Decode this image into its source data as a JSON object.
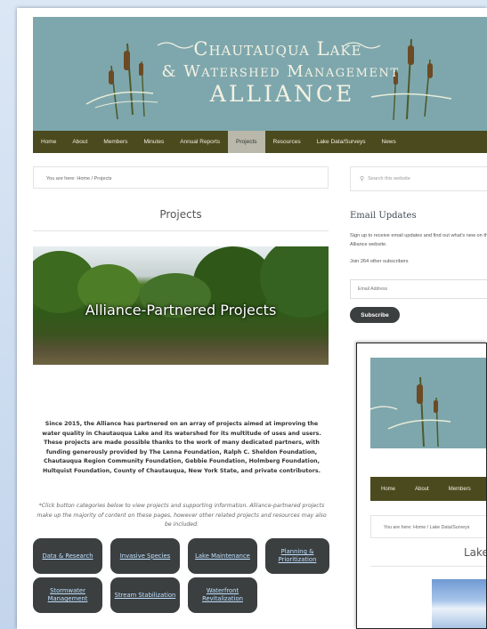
{
  "banner": {
    "line1": "Chautauqua Lake",
    "line2": "& Watershed Management",
    "line3": "ALLIANCE"
  },
  "nav": {
    "items": [
      "Home",
      "About",
      "Members",
      "Minutes",
      "Annual Reports",
      "Projects",
      "Resources",
      "Lake Data/Surveys",
      "News"
    ],
    "active": "Projects"
  },
  "breadcrumb": "You are here: Home / Projects",
  "page_title": "Projects",
  "hero_title": "Alliance-Partnered Projects",
  "intro": "Since 2015, the Alliance has partnered on an array of projects aimed at improving the water quality in Chautauqua Lake and its watershed for its multitude of uses and users. These projects are made possible thanks to the work of many dedicated partners, with funding generously provided by The Lenna Foundation, Ralph C. Sheldon Foundation, Chautauqua Region Community Foundation, Gebbie Foundation, Holmberg Foundation, Hultquist Foundation, County of Chautauqua, New York State, and private contributors.",
  "note": "*Click button categories below to view projects and supporting information. Alliance-partnered projects make up the majority of content on these pages, however other related projects and resources may also be included.",
  "categories": [
    "Data & Research",
    "Invasive Species",
    "Lake Maintenance",
    "Planning & Prioritization",
    "Stormwater Management",
    "Stream Stabilization",
    "Waterfront Revitalization"
  ],
  "sidebar": {
    "search_placeholder": "Search this website",
    "email_title": "Email Updates",
    "email_desc": "Sign up to receive email updates and find out what's new on the Alliance website.",
    "join_text": "Join 264 other subscribers",
    "email_placeholder": "Email Address",
    "subscribe_label": "Subscribe"
  },
  "overlay": {
    "nav_items": [
      "Home",
      "About",
      "Members"
    ],
    "breadcrumb": "You are here: Home / Lake Data/Surveys",
    "title": "Lake"
  },
  "colors": {
    "banner": "#7ea7ad",
    "nav": "#4a4a1e",
    "button": "#3b3f40",
    "button_text": "#bfe0ff"
  }
}
